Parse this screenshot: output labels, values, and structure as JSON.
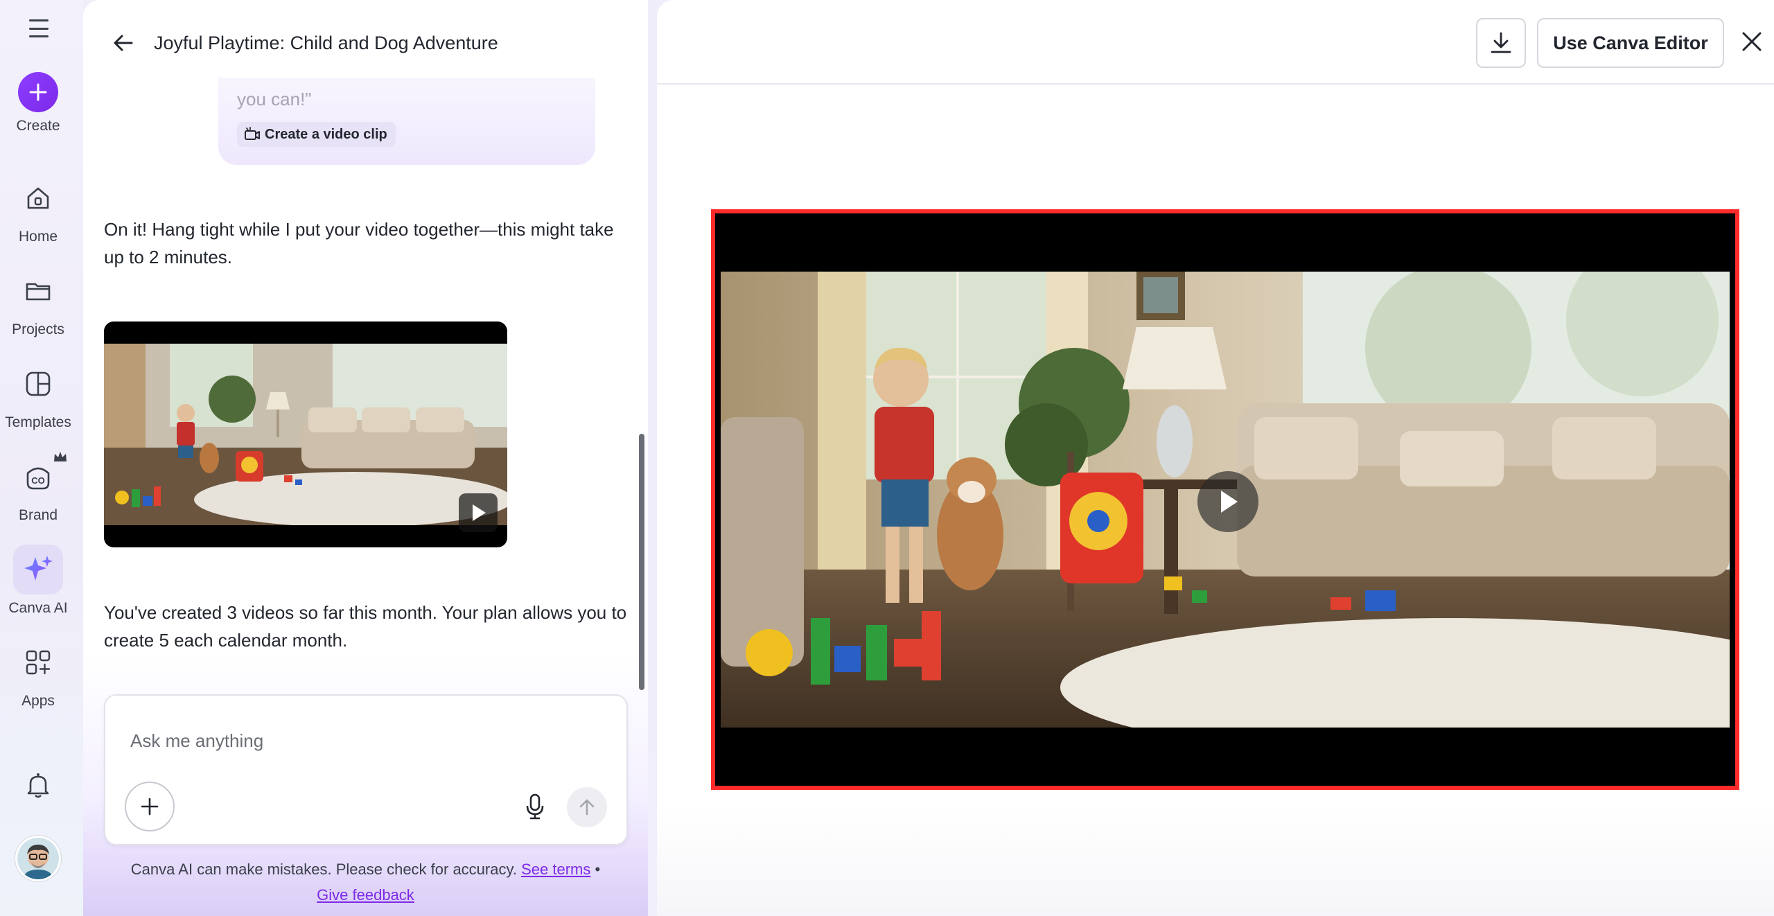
{
  "rail": {
    "items": [
      {
        "label": "Create",
        "icon": "plus-icon"
      },
      {
        "label": "Home",
        "icon": "home-icon"
      },
      {
        "label": "Projects",
        "icon": "folder-icon"
      },
      {
        "label": "Templates",
        "icon": "templates-icon"
      },
      {
        "label": "Brand",
        "icon": "brand-icon"
      },
      {
        "label": "Canva AI",
        "icon": "sparkle-icon"
      },
      {
        "label": "Apps",
        "icon": "apps-icon"
      }
    ]
  },
  "chat": {
    "title": "Joyful Playtime: Child and Dog Adventure",
    "user_bubble_fragment": "you can!\"",
    "clip_chip_label": "Create a video clip",
    "reply_1": "On it! Hang tight while I put your video together—this might take up to 2 minutes.",
    "reply_2": "You've created 3 videos so far this month. Your plan allows you to create 5 each calendar month.",
    "input_placeholder": "Ask me anything",
    "disclaimer_text": "Canva AI can make mistakes. Please check for accuracy.",
    "see_terms": "See terms",
    "bullet": "•",
    "give_feedback": "Give feedback"
  },
  "preview": {
    "use_editor_label": "Use Canva Editor"
  },
  "colors": {
    "accent": "#7d2ae8",
    "selection_border": "#ff2b2b"
  }
}
